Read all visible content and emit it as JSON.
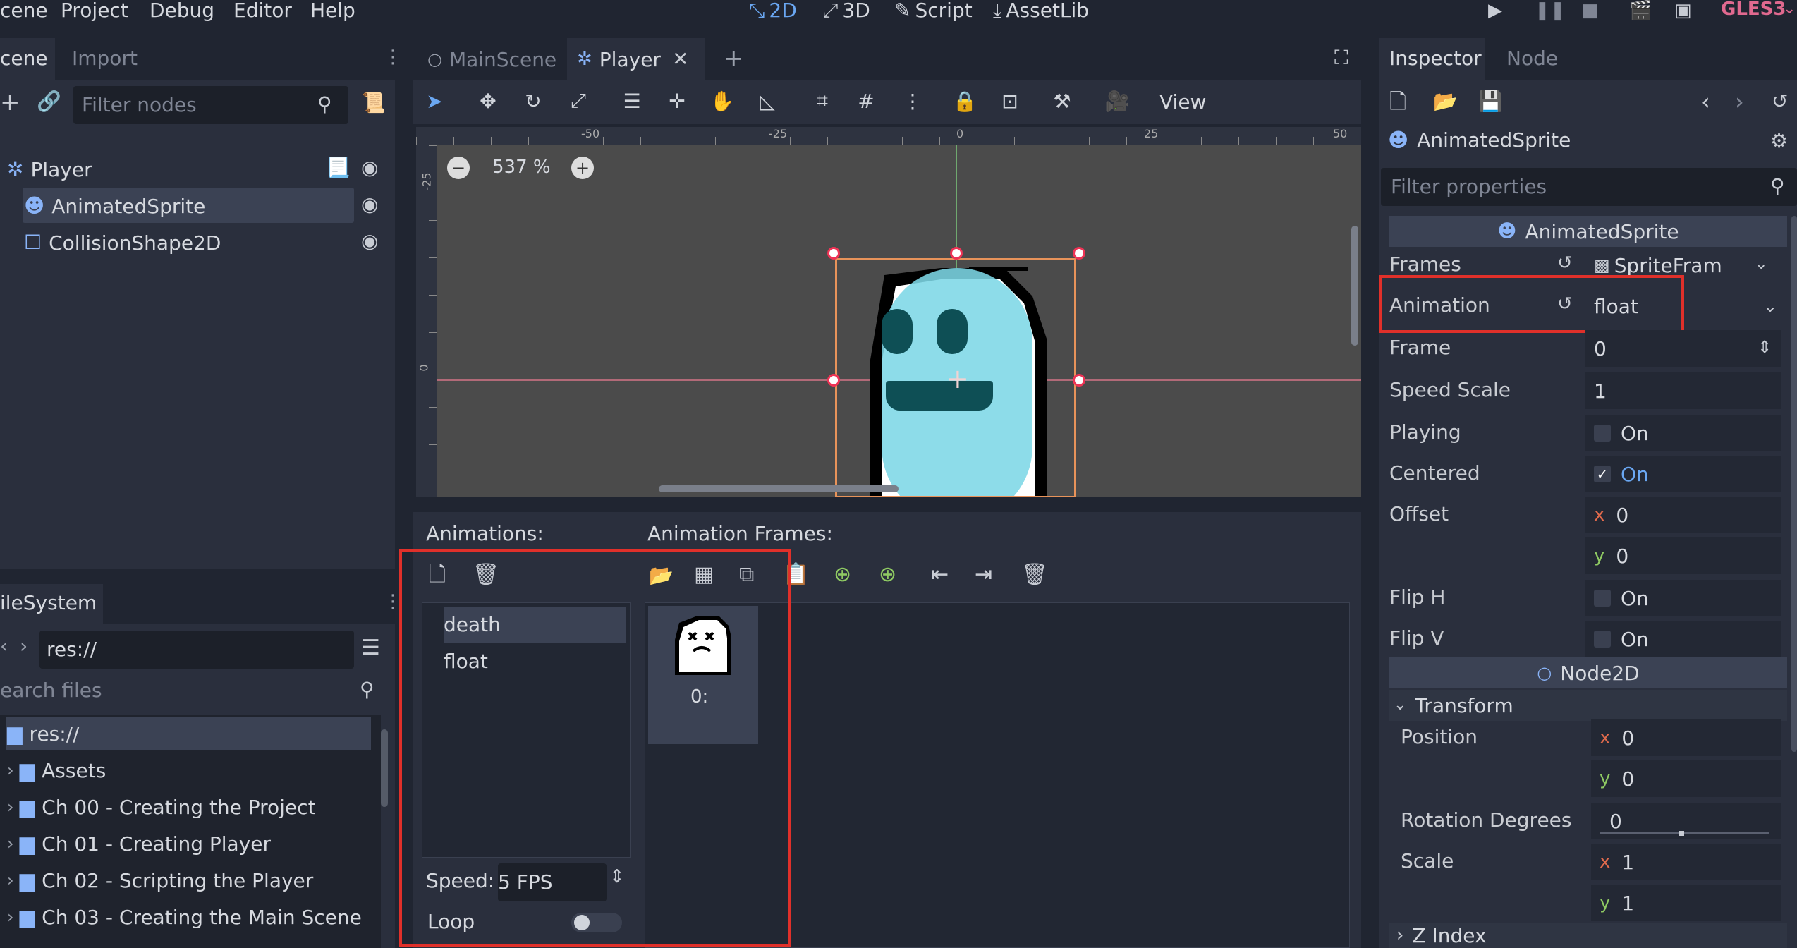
{
  "menu": {
    "items": [
      "cene",
      "Project",
      "Debug",
      "Editor",
      "Help"
    ]
  },
  "workspaces": {
    "d2": "2D",
    "d3": "3D",
    "script": "Script",
    "assetlib": "AssetLib"
  },
  "renderer": "GLES3",
  "scene_dock": {
    "tabs": [
      "cene",
      "Import"
    ],
    "filter_placeholder": "Filter nodes",
    "nodes": [
      {
        "label": "Player"
      },
      {
        "label": "AnimatedSprite"
      },
      {
        "label": "CollisionShape2D"
      }
    ]
  },
  "filesystem": {
    "tab": "ileSystem",
    "path": "res://",
    "search_placeholder": "earch files",
    "items": [
      "res://",
      "Assets",
      "Ch 00 - Creating the Project",
      "Ch 01 - Creating Player",
      "Ch 02 - Scripting the Player",
      "Ch 03 - Creating the Main Scene"
    ]
  },
  "editor_tabs": [
    "MainScene",
    "Player"
  ],
  "viewport": {
    "view_menu": "View",
    "zoom": "537 %",
    "ruler_top": [
      "-50",
      "-25",
      "0",
      "25",
      "50"
    ],
    "ruler_left": [
      "-25",
      "0"
    ]
  },
  "sprite_frames": {
    "animations_label": "Animations:",
    "frames_label": "Animation Frames:",
    "animations": [
      "death",
      "float"
    ],
    "frame_label": "0:",
    "speed_label": "Speed:",
    "speed_value": "5 FPS",
    "loop_label": "Loop"
  },
  "inspector": {
    "tabs": [
      "Inspector",
      "Node"
    ],
    "node_name": "AnimatedSprite",
    "filter_placeholder": "Filter properties",
    "section": "AnimatedSprite",
    "props": {
      "frames": {
        "label": "Frames",
        "value": "SpriteFram"
      },
      "animation": {
        "label": "Animation",
        "value": "float"
      },
      "frame": {
        "label": "Frame",
        "value": "0"
      },
      "speed_scale": {
        "label": "Speed Scale",
        "value": "1"
      },
      "playing": {
        "label": "Playing",
        "value": "On"
      },
      "centered": {
        "label": "Centered",
        "value": "On"
      },
      "offset": {
        "label": "Offset",
        "x": "0",
        "y": "0"
      },
      "flip_h": {
        "label": "Flip H",
        "value": "On"
      },
      "flip_v": {
        "label": "Flip V",
        "value": "On"
      }
    },
    "node2d_section": "Node2D",
    "transform": {
      "label": "Transform",
      "position": {
        "label": "Position",
        "x": "0",
        "y": "0"
      },
      "rotation": {
        "label": "Rotation Degrees",
        "value": "0"
      },
      "scale": {
        "label": "Scale",
        "x": "1",
        "y": "1"
      }
    },
    "z_index": "Z Index",
    "axis_x": "x",
    "axis_y": "y"
  },
  "colors": {
    "accent": "#6aa7f2",
    "highlight_box": "#e0302a",
    "selection": "#3b4254"
  }
}
